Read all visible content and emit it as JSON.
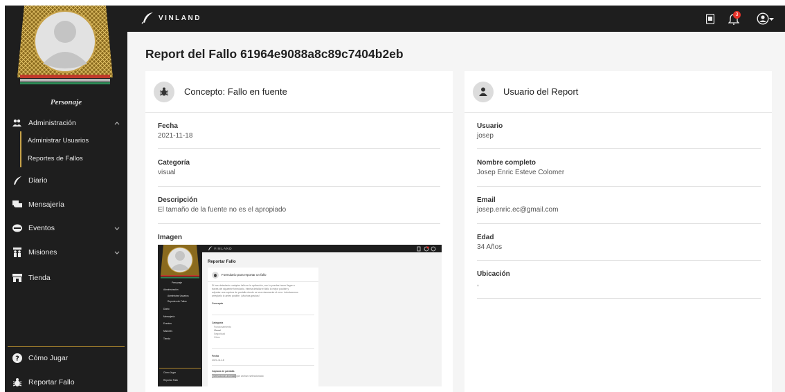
{
  "app": {
    "brand_name": "VINLAND",
    "notifications_count": "3",
    "colors": {
      "bar": "#1e1e1e",
      "accent_gold": "#c8a34a",
      "badge": "#e6332a",
      "background": "#f5f5f5"
    }
  },
  "sidebar": {
    "character_name": "Personaje",
    "menu": [
      {
        "label": "Administración",
        "icon": "users-cog-icon",
        "expanded": true
      },
      {
        "label": "Administrar Usuarios"
      },
      {
        "label": "Reportes de Fallos"
      },
      {
        "label": "Diario",
        "icon": "quill-icon"
      },
      {
        "label": "Mensajería",
        "icon": "chat-icon"
      },
      {
        "label": "Eventos",
        "icon": "disc-icon",
        "expanded": false
      },
      {
        "label": "Misiones",
        "icon": "people-icon",
        "expanded": false
      },
      {
        "label": "Tienda",
        "icon": "store-icon"
      }
    ],
    "footer": [
      {
        "label": "Cómo Jugar",
        "icon": "question-circle-icon"
      },
      {
        "label": "Reportar Fallo",
        "icon": "bug-icon"
      }
    ]
  },
  "page": {
    "title": "Report del Fallo 61964e9088a8c89c7404b2eb"
  },
  "concept_card": {
    "title": "Concepto: Fallo en fuente",
    "icon": "bug-icon",
    "fields": [
      {
        "label": "Fecha",
        "value": "2021-11-18"
      },
      {
        "label": "Categoría",
        "value": "visual"
      },
      {
        "label": "Descripción",
        "value": "El tamaño de la fuente no es el apropiado"
      },
      {
        "label": "Imagen",
        "value": ""
      }
    ]
  },
  "user_card": {
    "title": "Usuario del Report",
    "icon": "user-icon",
    "fields": [
      {
        "label": "Usuario",
        "value": "josep"
      },
      {
        "label": "Nombre completo",
        "value": "Josep Enric Esteve Colomer"
      },
      {
        "label": "Email",
        "value": "josep.enric.ec@gmail.com"
      },
      {
        "label": "Edad",
        "value": "34 Años"
      },
      {
        "label": "Ubicación",
        "value": ","
      }
    ]
  },
  "attached_screenshot": {
    "brand_name": "VINLAND",
    "character_name": "Personaje",
    "page_title": "Reportar Fallo",
    "form_title": "Formulario para reportar un fallo",
    "intro_lines": [
      "Si has detectado cualquier fallo en la aplicación, con lo puedes hacer llegar a",
      "través del siguiente formulario. Intenta detallar el fallo lo mejor posible y",
      "adjuntar una captura de pantalla donde se vea claramente el error. Intentaremos",
      "arreglarlo lo antes posible. ¡Muchas gracias!"
    ],
    "concept_label": "Concepto",
    "category_label": "Categoría",
    "category_options": [
      "Funcionamiento",
      "Visual",
      "Seguridad",
      "Otros"
    ],
    "date_label": "Fecha",
    "date_value": "2021-11-18",
    "capture_label": "Captura de pantalla",
    "file_button": "Seleccionar archivo",
    "file_status": "Ningún archivo seleccionado",
    "menu": [
      "Administración",
      "Administrar Usuarios",
      "Reportes de Fallos",
      "Diario",
      "Mensajería",
      "Eventos",
      "Misiones",
      "Tienda"
    ],
    "footer": [
      "Cómo Jugar",
      "Reportar Fallo"
    ]
  }
}
